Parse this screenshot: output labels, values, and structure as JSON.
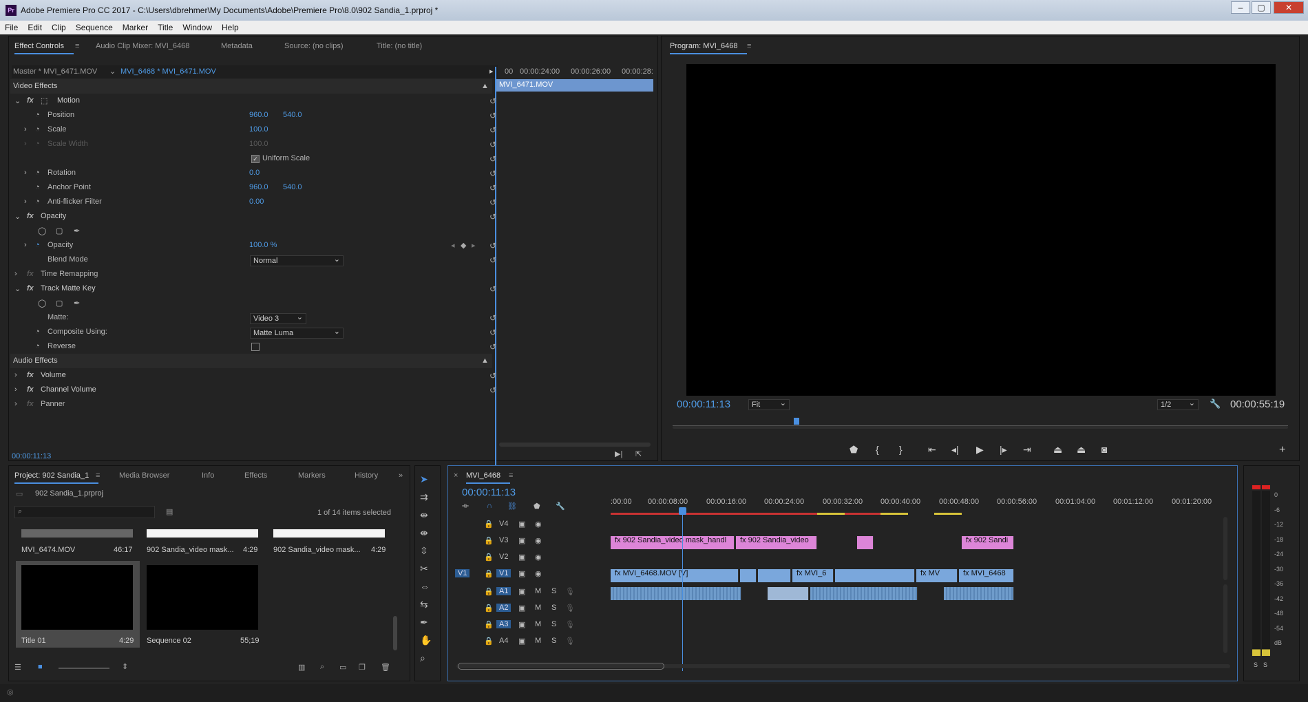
{
  "window": {
    "title": "Adobe Premiere Pro CC 2017 - C:\\Users\\dbrehmer\\My Documents\\Adobe\\Premiere Pro\\8.0\\902 Sandia_1.prproj *",
    "logo": "Pr"
  },
  "menu": [
    "File",
    "Edit",
    "Clip",
    "Sequence",
    "Marker",
    "Title",
    "Window",
    "Help"
  ],
  "effect_panel": {
    "tabs": [
      "Effect Controls",
      "Audio Clip Mixer: MVI_6468",
      "Metadata",
      "Source: (no clips)",
      "Title: (no title)"
    ],
    "master": "Master * MVI_6471.MOV",
    "clip": "MVI_6468 * MVI_6471.MOV",
    "ruler": [
      "00",
      "00:00:24:00",
      "00:00:26:00",
      "00:00:28:"
    ],
    "mini_clip": "MVI_6471.MOV",
    "video_effects": "Video Effects",
    "motion": "Motion",
    "position": {
      "label": "Position",
      "x": "960.0",
      "y": "540.0"
    },
    "scale": {
      "label": "Scale",
      "value": "100.0"
    },
    "scale_width": {
      "label": "Scale Width",
      "value": "100.0"
    },
    "uniform_scale": "Uniform Scale",
    "rotation": {
      "label": "Rotation",
      "value": "0.0"
    },
    "anchor": {
      "label": "Anchor Point",
      "x": "960.0",
      "y": "540.0"
    },
    "antiflicker": {
      "label": "Anti-flicker Filter",
      "value": "0.00"
    },
    "opacity_fx": "Opacity",
    "opacity": {
      "label": "Opacity",
      "value": "100.0 %"
    },
    "blend": {
      "label": "Blend Mode",
      "value": "Normal"
    },
    "time_remap": "Time Remapping",
    "track_matte": "Track Matte Key",
    "matte": {
      "label": "Matte:",
      "value": "Video 3"
    },
    "composite": {
      "label": "Composite Using:",
      "value": "Matte Luma"
    },
    "reverse": "Reverse",
    "audio_effects": "Audio Effects",
    "volume": "Volume",
    "channel_volume": "Channel Volume",
    "panner": "Panner",
    "timecode": "00:00:11:13"
  },
  "program": {
    "title": "Program: MVI_6468",
    "timecode": "00:00:11:13",
    "fit": "Fit",
    "res": "1/2",
    "duration": "00:00:55:19"
  },
  "project": {
    "tabs": [
      "Project: 902 Sandia_1",
      "Media Browser",
      "Info",
      "Effects",
      "Markers",
      "History"
    ],
    "file": "902 Sandia_1.prproj",
    "selected": "1 of 14 items selected",
    "items": [
      {
        "name": "MVI_6474.MOV",
        "dur": "46:17"
      },
      {
        "name": "902 Sandia_video mask...",
        "dur": "4:29"
      },
      {
        "name": "902 Sandia_video mask...",
        "dur": "4:29"
      },
      {
        "name": "Title 01",
        "dur": "4:29"
      },
      {
        "name": "Sequence 02",
        "dur": "55;19"
      }
    ]
  },
  "timeline": {
    "tab": "MVI_6468",
    "timecode": "00:00:11:13",
    "ruler": [
      ":00:00",
      "00:00:08:00",
      "00:00:16:00",
      "00:00:24:00",
      "00:00:32:00",
      "00:00:40:00",
      "00:00:48:00",
      "00:00:56:00",
      "00:01:04:00",
      "00:01:12:00",
      "00:01:20:00"
    ],
    "tracks": [
      "V4",
      "V3",
      "V2",
      "V1",
      "A1",
      "A2",
      "A3",
      "A4"
    ],
    "source_v": "V1",
    "mute": "M",
    "solo": "S",
    "clips_v3": [
      "902 Sandia_video mask_handl",
      "902 Sandia_video",
      "902 Sandi"
    ],
    "clips_v1": [
      "MVI_6468.MOV [V]",
      "MVI_6",
      "MV",
      "MVI_6468"
    ]
  },
  "meter": {
    "scale": [
      "0",
      "-6",
      "-12",
      "-18",
      "-24",
      "-30",
      "-36",
      "-42",
      "-48",
      "-54",
      "dB"
    ],
    "solo": [
      "S",
      "S"
    ]
  },
  "colors": {
    "accent": "#4f9be6",
    "video_clip": "#7aa7dc",
    "pink_clip": "#dd85d8",
    "bg": "#232323"
  }
}
